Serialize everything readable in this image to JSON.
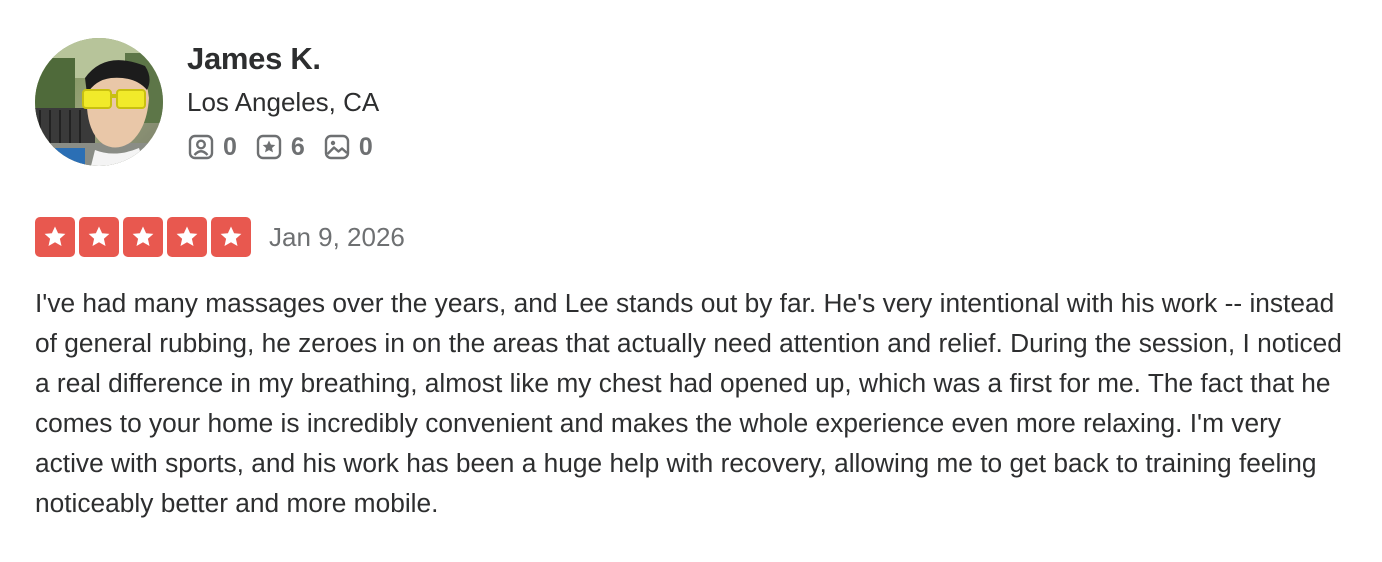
{
  "user": {
    "name": "James K.",
    "location": "Los Angeles, CA",
    "avatar_icon": "user-avatar-photo",
    "stats": {
      "friends": {
        "icon": "friends-icon",
        "count": "0"
      },
      "reviews": {
        "icon": "reviews-star-icon",
        "count": "6"
      },
      "photos": {
        "icon": "photos-icon",
        "count": "0"
      }
    }
  },
  "review": {
    "rating": 5,
    "max_rating": 5,
    "date": "Jan 9, 2026",
    "text": "I've had many massages over the years, and Lee stands out by far. He's very intentional with his work -- instead of general rubbing, he zeroes in on the areas that actually need attention and relief. During the session, I noticed a real difference in my breathing, almost like my chest had opened up, which was a first for me. The fact that he comes to your home is incredibly convenient and makes the whole experience even more relaxing. I'm very active with sports, and his work has been a huge help with recovery, allowing me to get back to training feeling noticeably better and more mobile."
  },
  "colors": {
    "star_red": "#e8584f",
    "text_dark": "#2d2e2f",
    "text_gray": "#6e7072"
  }
}
